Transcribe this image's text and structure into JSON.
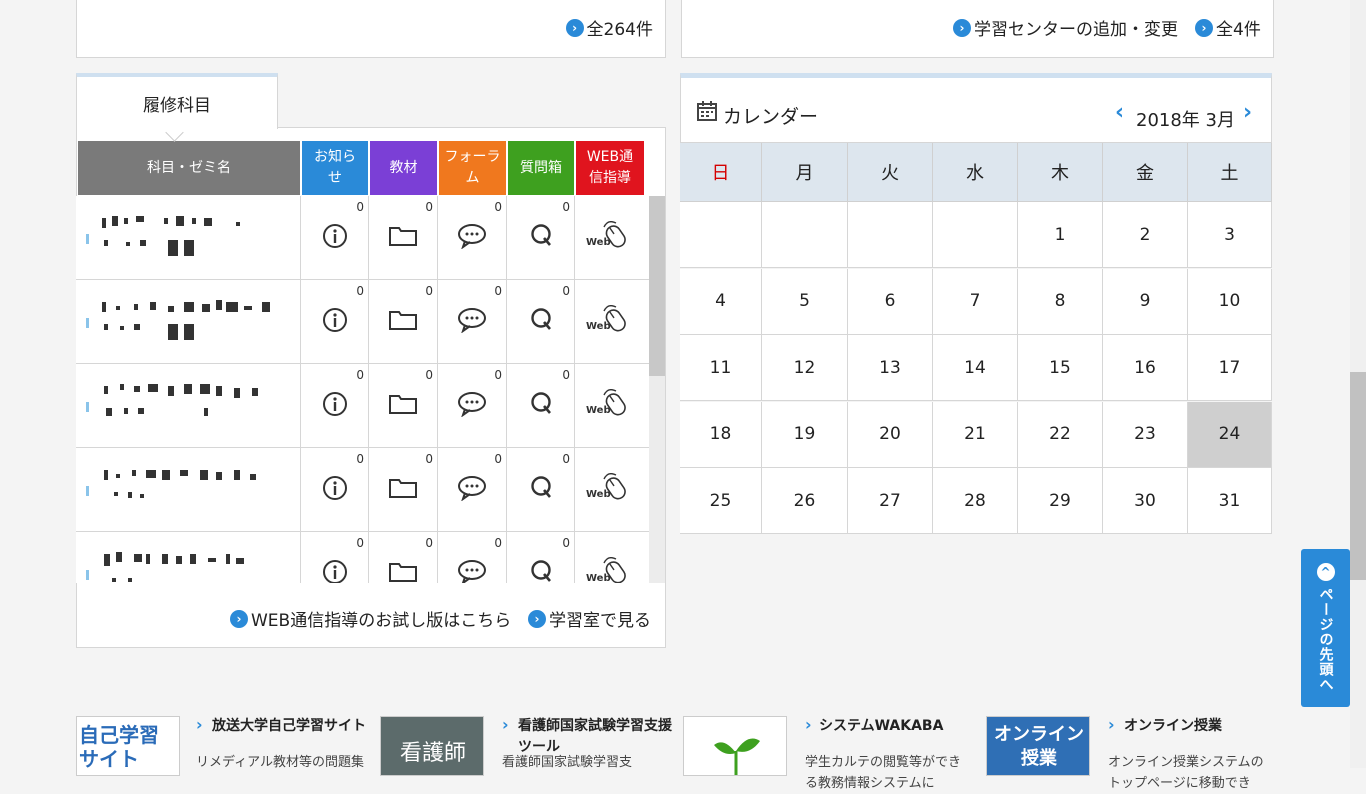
{
  "top_panels": {
    "left_link": "全264件",
    "right_link_add": "学習センターの追加・変更",
    "right_link_all": "全4件"
  },
  "courses": {
    "tab_label": "履修科目",
    "headers": {
      "name": "科目・ゼミ名",
      "news": "お知らせ",
      "materials": "教材",
      "forum": "フォーラム",
      "questions": "質問箱",
      "web": "WEB通信指導"
    },
    "header_colors": {
      "name": "#7a7a7a",
      "news": "#2a8ad8",
      "materials": "#7b3fd6",
      "forum": "#f0781e",
      "questions": "#3ea01f",
      "web": "#e0141e"
    },
    "counts": [
      "0",
      "0",
      "0",
      "0"
    ],
    "web_label": "Web",
    "footer_trial": "WEB通信指導のお試し版はこちら",
    "footer_room": "学習室で見る"
  },
  "calendar": {
    "title": "カレンダー",
    "month": "2018年 3月",
    "weekdays": [
      "日",
      "月",
      "火",
      "水",
      "木",
      "金",
      "土"
    ],
    "weeks": [
      [
        "",
        "",
        "",
        "",
        "1",
        "2",
        "3"
      ],
      [
        "4",
        "5",
        "6",
        "7",
        "8",
        "9",
        "10"
      ],
      [
        "11",
        "12",
        "13",
        "14",
        "15",
        "16",
        "17"
      ],
      [
        "18",
        "19",
        "20",
        "21",
        "22",
        "23",
        "24"
      ],
      [
        "25",
        "26",
        "27",
        "28",
        "29",
        "30",
        "31"
      ]
    ],
    "today": "24",
    "sunday_color": "#d40000"
  },
  "to_top": "ページの先頭へ",
  "banners": [
    {
      "img_text": "自己学習サイト",
      "title": "放送大学自己学習サイト",
      "desc": "リメディアル教材等の問題集"
    },
    {
      "img_text": "看護師",
      "title": "看護師国家試験学習支援ツール",
      "desc": "看護師国家試験学習支"
    },
    {
      "img_text": "",
      "title": "システムWAKABA",
      "desc": "学生カルテの閲覧等ができる教務情報システムに"
    },
    {
      "img_text": "オンライン授業",
      "title": "オンライン授業",
      "desc": "オンライン授業システムのトップページに移動でき"
    }
  ]
}
